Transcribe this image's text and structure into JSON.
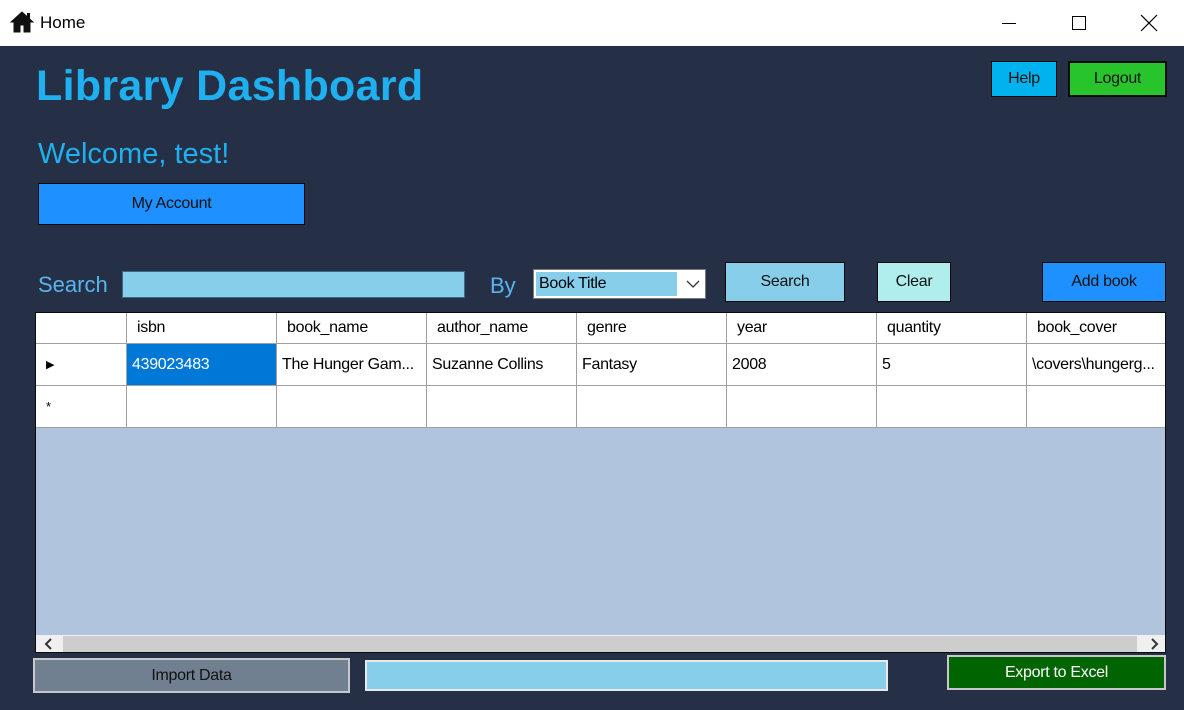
{
  "window": {
    "title": "Home",
    "app_icon": "home-icon",
    "controls": {
      "minimize": "minimize-icon",
      "maximize": "maximize-icon",
      "close": "close-icon"
    }
  },
  "header": {
    "title": "Library Dashboard",
    "welcome": "Welcome, test!",
    "help_label": "Help",
    "logout_label": "Logout",
    "account_label": "My Account"
  },
  "search": {
    "label": "Search",
    "value": "",
    "by_label": "By",
    "by_selected": "Book Title",
    "search_label": "Search",
    "clear_label": "Clear",
    "add_label": "Add book"
  },
  "grid": {
    "columns": [
      "isbn",
      "book_name",
      "author_name",
      "genre",
      "year",
      "quantity",
      "book_cover"
    ],
    "rows": [
      [
        "439023483",
        "The Hunger Gam...",
        "Suzanne Collins",
        "Fantasy",
        "2008",
        "5",
        "\\covers\\hungerg..."
      ]
    ],
    "current_row_marker": "▶",
    "new_row_marker": "*"
  },
  "footer": {
    "import_label": "Import Data",
    "progress": 0,
    "export_label": "Export to Excel"
  },
  "colors": {
    "background": "#253046",
    "title_text": "#1fb0f0",
    "help": "#00b2ee",
    "logout": "#27c52b",
    "account": "#1e90ff",
    "search_field": "#87ceeb",
    "clear": "#b0eeee",
    "add_book": "#1e90ff",
    "grid_background": "#b0c4de",
    "selected_cell": "#0078d7",
    "import": "#708090",
    "export": "#006400"
  }
}
